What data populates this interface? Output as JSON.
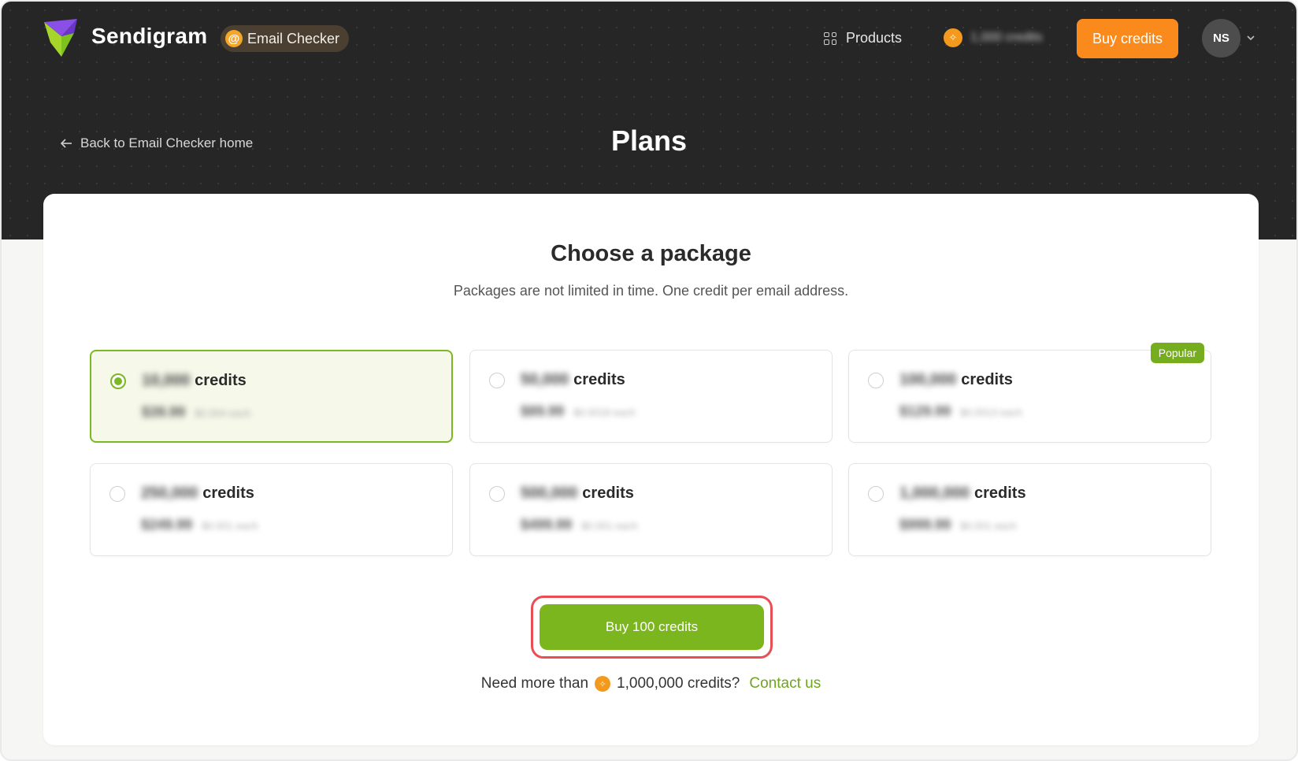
{
  "header": {
    "brand": "Sendigram",
    "product_badge": "Email Checker",
    "nav_products": "Products",
    "credits_balance": "1,000 credits",
    "buy_credits": "Buy credits",
    "avatar_initials": "NS"
  },
  "hero": {
    "back_link": "Back to Email Checker home",
    "title": "Plans"
  },
  "card": {
    "title": "Choose a package",
    "subtitle": "Packages are not limited in time. One credit per email address."
  },
  "packages": [
    {
      "amount": "10,000",
      "unit": "credits",
      "price": "$39.99",
      "per": "$0.004 each",
      "selected": true
    },
    {
      "amount": "50,000",
      "unit": "credits",
      "price": "$89.99",
      "per": "$0.0018 each",
      "selected": false
    },
    {
      "amount": "100,000",
      "unit": "credits",
      "price": "$129.99",
      "per": "$0.0013 each",
      "selected": false,
      "badge": "Popular"
    },
    {
      "amount": "250,000",
      "unit": "credits",
      "price": "$249.99",
      "per": "$0.001 each",
      "selected": false
    },
    {
      "amount": "500,000",
      "unit": "credits",
      "price": "$499.99",
      "per": "$0.001 each",
      "selected": false
    },
    {
      "amount": "1,000,000",
      "unit": "credits",
      "price": "$999.99",
      "per": "$0.001 each",
      "selected": false
    }
  ],
  "cta": {
    "buy_label": "Buy 100 credits"
  },
  "footer": {
    "need_more": "Need more than",
    "amount": "1,000,000 credits?",
    "contact": "Contact us"
  },
  "colors": {
    "accent_green": "#7cb61f",
    "accent_orange": "#fb8a1d",
    "highlight_red": "#ea4e55",
    "hero_bg": "#262626"
  }
}
